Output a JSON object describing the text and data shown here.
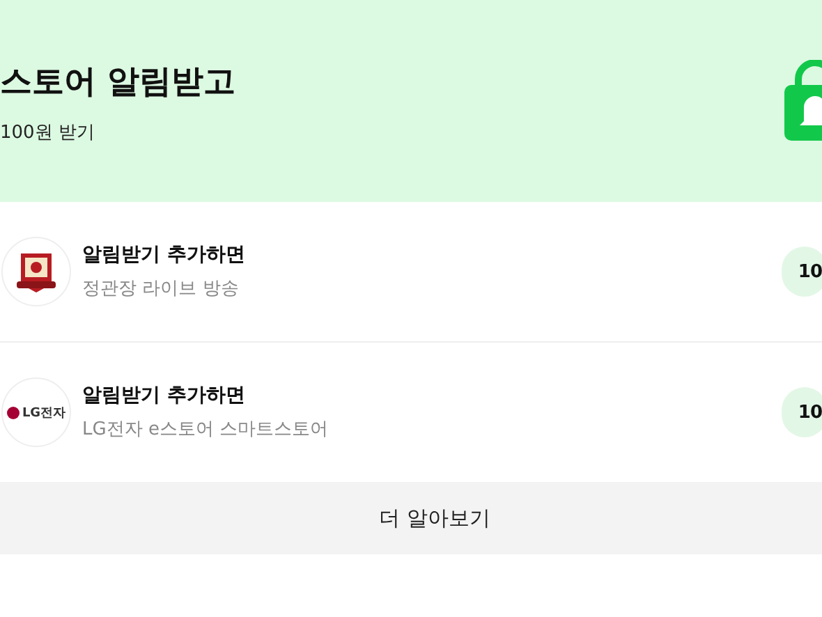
{
  "banner": {
    "title": "스토어 알림받고",
    "subtitle": "100원 받기"
  },
  "stores": [
    {
      "kind": "ginseng",
      "title": "알림받기 추가하면",
      "name": "정관장 라이브 방송",
      "reward": "10"
    },
    {
      "kind": "lg",
      "logo_text": "LG전자",
      "title": "알림받기 추가하면",
      "name": "LG전자 e스토어 스마트스토어",
      "reward": "10"
    }
  ],
  "more_button": "더 알아보기"
}
